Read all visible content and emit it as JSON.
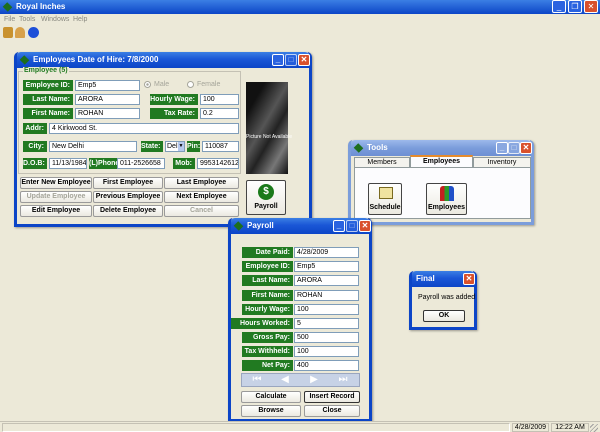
{
  "app": {
    "title": "Royal Inches"
  },
  "menu": [
    "File",
    "Tools",
    "Windows",
    "Help"
  ],
  "employee_window": {
    "title": "Employees Date of Hire:  7/8/2000",
    "group_label": "Employee (5)",
    "fields": {
      "employee_id": {
        "label": "Employee ID",
        "value": "Emp5"
      },
      "last_name": {
        "label": "Last Name",
        "value": "ARORA"
      },
      "first_name": {
        "label": "First Name",
        "value": "ROHAN"
      },
      "addr": {
        "label": "Addr",
        "value": "4 Kirkwood St."
      },
      "city": {
        "label": "City",
        "value": "New Delhi"
      },
      "state": {
        "label": "State",
        "value": "Del"
      },
      "pin": {
        "label": "Pin",
        "value": "110087"
      },
      "dob": {
        "label": "D.O.B",
        "value": "11/13/1984"
      },
      "phone": {
        "label": "(L)Phone",
        "value": "011-2526658"
      },
      "mob": {
        "label": "Mob",
        "value": "9953142612"
      },
      "hourly_wage": {
        "label": "Hourly Wage",
        "value": "100"
      },
      "tax_rate": {
        "label": "Tax Rate",
        "value": "0.2"
      }
    },
    "gender": {
      "male": "Male",
      "female": "Female"
    },
    "photo_caption": "Picture Not Available",
    "buttons": {
      "enter_new": "Enter New Employee",
      "first": "First Employee",
      "last": "Last Employee",
      "update": "Update Employee",
      "previous": "Previous Employee",
      "next": "Next Employee",
      "edit": "Edit Employee",
      "delete": "Delete Employee",
      "cancel": "Cancel",
      "payroll": "Payroll"
    }
  },
  "tools_window": {
    "title": "Tools",
    "tabs": [
      "Members",
      "Employees",
      "Inventory"
    ],
    "buttons": {
      "schedule": "Schedule",
      "employees": "Employees"
    }
  },
  "payroll_window": {
    "title": "Payroll",
    "rows": [
      {
        "label": "Date Paid",
        "value": "4/28/2009"
      },
      {
        "label": "Employee ID",
        "value": "Emp5"
      },
      {
        "label": "Last Name",
        "value": "ARORA"
      },
      {
        "label": "First Name",
        "value": "ROHAN"
      },
      {
        "label": "Hourly Wage",
        "value": "100"
      },
      {
        "label": "Hours Worked",
        "value": "5"
      },
      {
        "label": "Gross Pay",
        "value": "500"
      },
      {
        "label": "Tax Withheld",
        "value": "100"
      },
      {
        "label": "Net Pay",
        "value": "400"
      }
    ],
    "buttons": {
      "calculate": "Calculate",
      "insert": "Insert Record",
      "browse": "Browse",
      "close": "Close"
    }
  },
  "dialog": {
    "title": "Final",
    "message": "Payroll was added",
    "ok": "OK"
  },
  "status": {
    "date": "4/28/2009",
    "time": "12:22 AM"
  },
  "colors": {
    "label_bg": "#217a21",
    "titlebar": "#0c45c7",
    "inactive_titlebar": "#7b9ddb",
    "desktop": "#ece9d8"
  }
}
